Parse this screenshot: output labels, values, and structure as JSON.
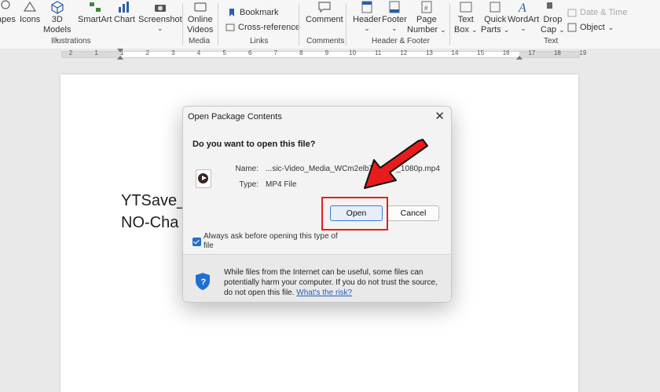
{
  "ribbon": {
    "shapes_label": "apes",
    "icons_label": "Icons",
    "models3d_label_1": "3D",
    "models3d_label_2": "Models",
    "smartart_label": "SmartArt",
    "chart_label": "Chart",
    "screenshot_label": "Screenshot",
    "illustrations_group": "Illustrations",
    "online_videos_1": "Online",
    "online_videos_2": "Videos",
    "media_group": "Media",
    "bookmark_label": "Bookmark",
    "crossref_label": "Cross-reference",
    "links_group": "Links",
    "comment_label": "Comment",
    "comments_group": "Comments",
    "header_label": "Header",
    "footer_label": "Footer",
    "page_number_1": "Page",
    "page_number_2": "Number",
    "header_footer_group": "Header & Footer",
    "textbox_1": "Text",
    "textbox_2": "Box",
    "quickparts_1": "Quick",
    "quickparts_2": "Parts",
    "wordart_label": "WordArt",
    "dropcap_1": "Drop",
    "dropcap_2": "Cap",
    "datetime_label": "Date & Time",
    "object_label": "Object",
    "text_group": "Text",
    "chevron": "⌄"
  },
  "ruler": {
    "numbers": [
      "2",
      "1",
      "1",
      "2",
      "3",
      "4",
      "5",
      "6",
      "7",
      "8",
      "9",
      "10",
      "11",
      "12",
      "13",
      "14",
      "15",
      "16",
      "17",
      "18",
      "19"
    ]
  },
  "document": {
    "line1": "YTSave_",
    "line2": "NO-Cha"
  },
  "dialog": {
    "title": "Open Package Contents",
    "close_glyph": "✕",
    "question": "Do you want to open this file?",
    "name_key": "Name:",
    "name_value": "...sic-Video_Media_WCm2elbTE",
    "name_value_end": "_1080p.mp4",
    "type_key": "Type:",
    "type_value": "MP4 File",
    "open_button": "Open",
    "cancel_button": "Cancel",
    "checkbox_label": "Always ask before opening this type of file",
    "checkbox_checked": true,
    "warning_text": "While files from the Internet can be useful, some files can potentially harm your computer. If you do not trust the source, do not open this file.",
    "warning_link": "What's the risk?"
  },
  "colors": {
    "accent": "#1f6fd1",
    "highlight_red": "#e81c1c",
    "link": "#1d5fbf"
  }
}
